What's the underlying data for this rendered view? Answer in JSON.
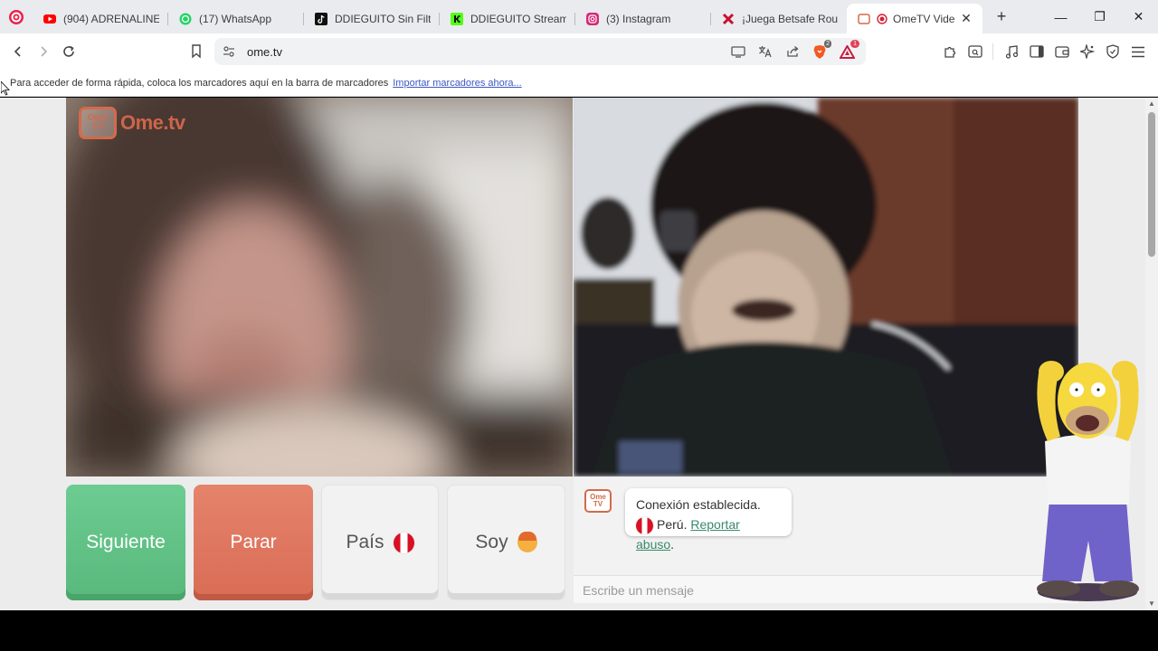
{
  "browser": {
    "tabs": [
      {
        "label": "(904) ADRENALINE",
        "icon": "youtube-icon",
        "active": false
      },
      {
        "label": "(17) WhatsApp",
        "icon": "whatsapp-icon",
        "active": false
      },
      {
        "label": "DDIEGUITO Sin Filtro",
        "icon": "tiktok-icon",
        "active": false
      },
      {
        "label": "DDIEGUITO Stream",
        "icon": "kick-icon",
        "active": false
      },
      {
        "label": "(3) Instagram",
        "icon": "instagram-icon",
        "active": false
      },
      {
        "label": "¡Juega Betsafe Roule",
        "icon": "betsafe-icon",
        "active": false
      },
      {
        "label": "OmeTV Vide",
        "icon": "ometv-icon",
        "active": true
      }
    ],
    "new_tab_label": "+",
    "address": "ome.tv",
    "brave_badge": "2",
    "rewards_badge": "1"
  },
  "bookmarks_bar": {
    "hint": "Para acceder de forma rápida, coloca los marcadores aquí en la barra de marcadores",
    "import_link": "Importar marcadores ahora..."
  },
  "ometv": {
    "logo_small": "Ome TV",
    "logo_text": "Ome.tv",
    "buttons": {
      "next": "Siguiente",
      "stop": "Parar",
      "country": "País",
      "me": "Soy"
    },
    "chat": {
      "icon_text": "Ome TV",
      "status": "Conexión establecida.",
      "country": "Perú.",
      "report": "Reportar abuso",
      "report_suffix": ".",
      "input_placeholder": "Escribe un mensaje"
    }
  },
  "colors": {
    "next": "#5fbf83",
    "stop": "#dd735b",
    "accent": "#e46d4e",
    "link": "#3a8a6a"
  }
}
